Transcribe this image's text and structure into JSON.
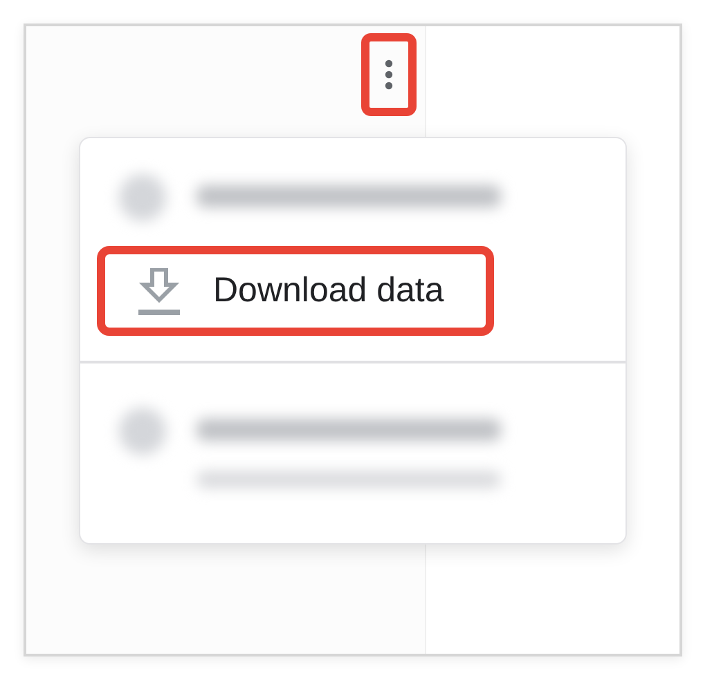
{
  "toolbar": {
    "more_button": {
      "highlighted": true
    }
  },
  "menu": {
    "sections": [
      {
        "items": [
          {
            "kind": "blurred"
          },
          {
            "kind": "action",
            "label": "Download data",
            "highlighted": true
          }
        ]
      },
      {
        "items": [
          {
            "kind": "blurred_with_detail"
          }
        ]
      }
    ]
  }
}
